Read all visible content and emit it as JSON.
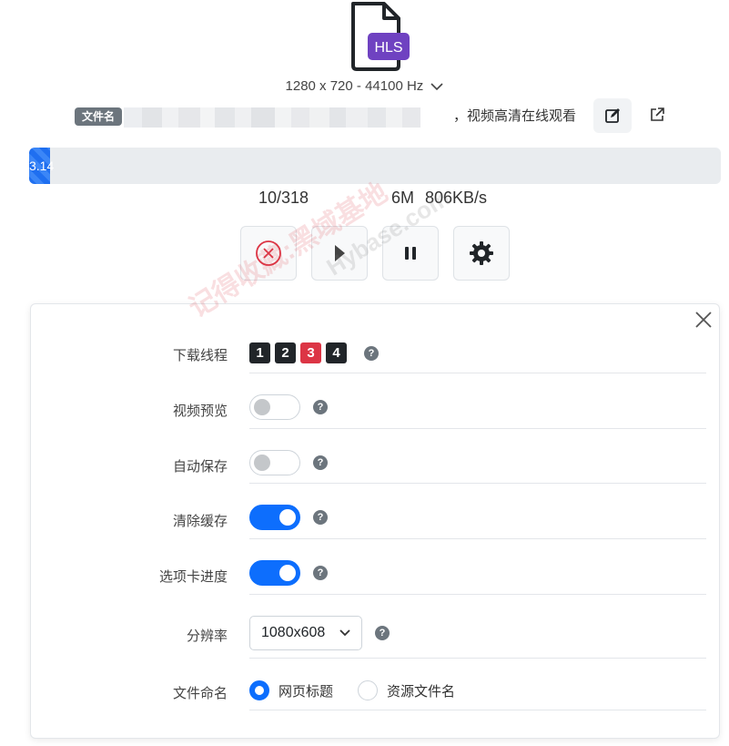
{
  "header": {
    "format_badge": "HLS",
    "format_info": "1280 x 720 - 44100 Hz"
  },
  "file": {
    "badge": "文件名",
    "name_visible": "，视频高清在线观看"
  },
  "progress": {
    "value_fraction": 0.03,
    "label": "3.14",
    "segments": "10/318",
    "size": "6M",
    "speed": "806KB/s"
  },
  "watermark": {
    "line1": "记得收藏:黑域基地",
    "line2": "Hybase.com"
  },
  "settings": {
    "threads_label": "下载线程",
    "threads": [
      "1",
      "2",
      "3",
      "4"
    ],
    "threads_selected": "3",
    "preview_label": "视频预览",
    "preview_on": false,
    "autosave_label": "自动保存",
    "autosave_on": false,
    "clear_cache_label": "清除缓存",
    "clear_cache_on": true,
    "tab_progress_label": "选项卡进度",
    "tab_progress_on": true,
    "resolution_label": "分辨率",
    "resolution_value": "1080x608",
    "naming_label": "文件命名",
    "naming_options": [
      "网页标题",
      "资源文件名"
    ],
    "naming_selected": "网页标题",
    "help_glyph": "?"
  },
  "colors": {
    "accent": "#0d6efd",
    "badge_purple": "#6f42c1",
    "danger": "#dc3545"
  }
}
